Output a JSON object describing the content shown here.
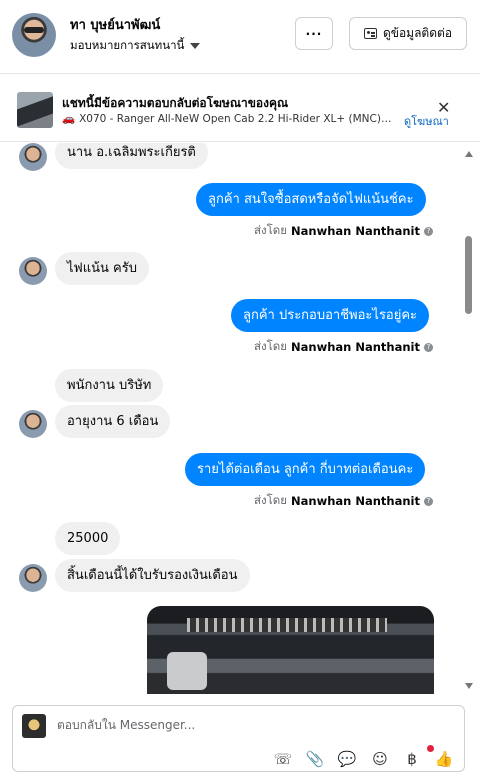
{
  "header": {
    "contact_name": "ทา บุษย์นาพัฒน์",
    "assignment": "มอบหมายการสนทนานี้",
    "more_label": "···",
    "contact_info_label": "ดูข้อมูลติดต่อ"
  },
  "ad_banner": {
    "title": "แชทนี้มีข้อความตอบกลับต่อโฆษณาของคุณ",
    "description": "X070 - Ranger All-NeW Open Cab 2.2 Hi-Rider XL+ (MNC) MT ...",
    "close_label": "✕",
    "view_ad_label": "ดูโฆษณา"
  },
  "messages": [
    {
      "text": "นาน อ.เฉลิมพระเกียรติ",
      "direction": "in"
    },
    {
      "text": "ลูกค้า สนใจซื้อสดหรือจัดไฟแน้นช์คะ",
      "direction": "out",
      "sent_by_prefix": "ส่งโดย",
      "sent_by_name": "Nanwhan Nanthanit"
    },
    {
      "text": "ไฟแน้น ครับ",
      "direction": "in"
    },
    {
      "text": "ลูกค้า ประกอบอาชีพอะไรอยู่คะ",
      "direction": "out",
      "sent_by_prefix": "ส่งโดย",
      "sent_by_name": "Nanwhan Nanthanit"
    },
    {
      "text": "พนักงาน บริษัท",
      "direction": "in"
    },
    {
      "text": "อายุงาน 6 เดือน",
      "direction": "in"
    },
    {
      "text": "รายได้ต่อเดือน ลูกค้า กี่บาทต่อเดือนคะ",
      "direction": "out",
      "sent_by_prefix": "ส่งโดย",
      "sent_by_name": "Nanwhan Nanthanit"
    },
    {
      "text": "25000",
      "direction": "in"
    },
    {
      "text": "สิ้นเดือนนี้ได้ใบรับรองเงินเดือน",
      "direction": "in"
    }
  ],
  "composer": {
    "placeholder": "ตอบกลับใน Messenger..."
  },
  "toolbar_icons": [
    "add-contact-icon",
    "attachment-icon",
    "chat-bubble-icon",
    "emoji-icon",
    "baht-payment-icon",
    "thumbs-up-icon"
  ]
}
